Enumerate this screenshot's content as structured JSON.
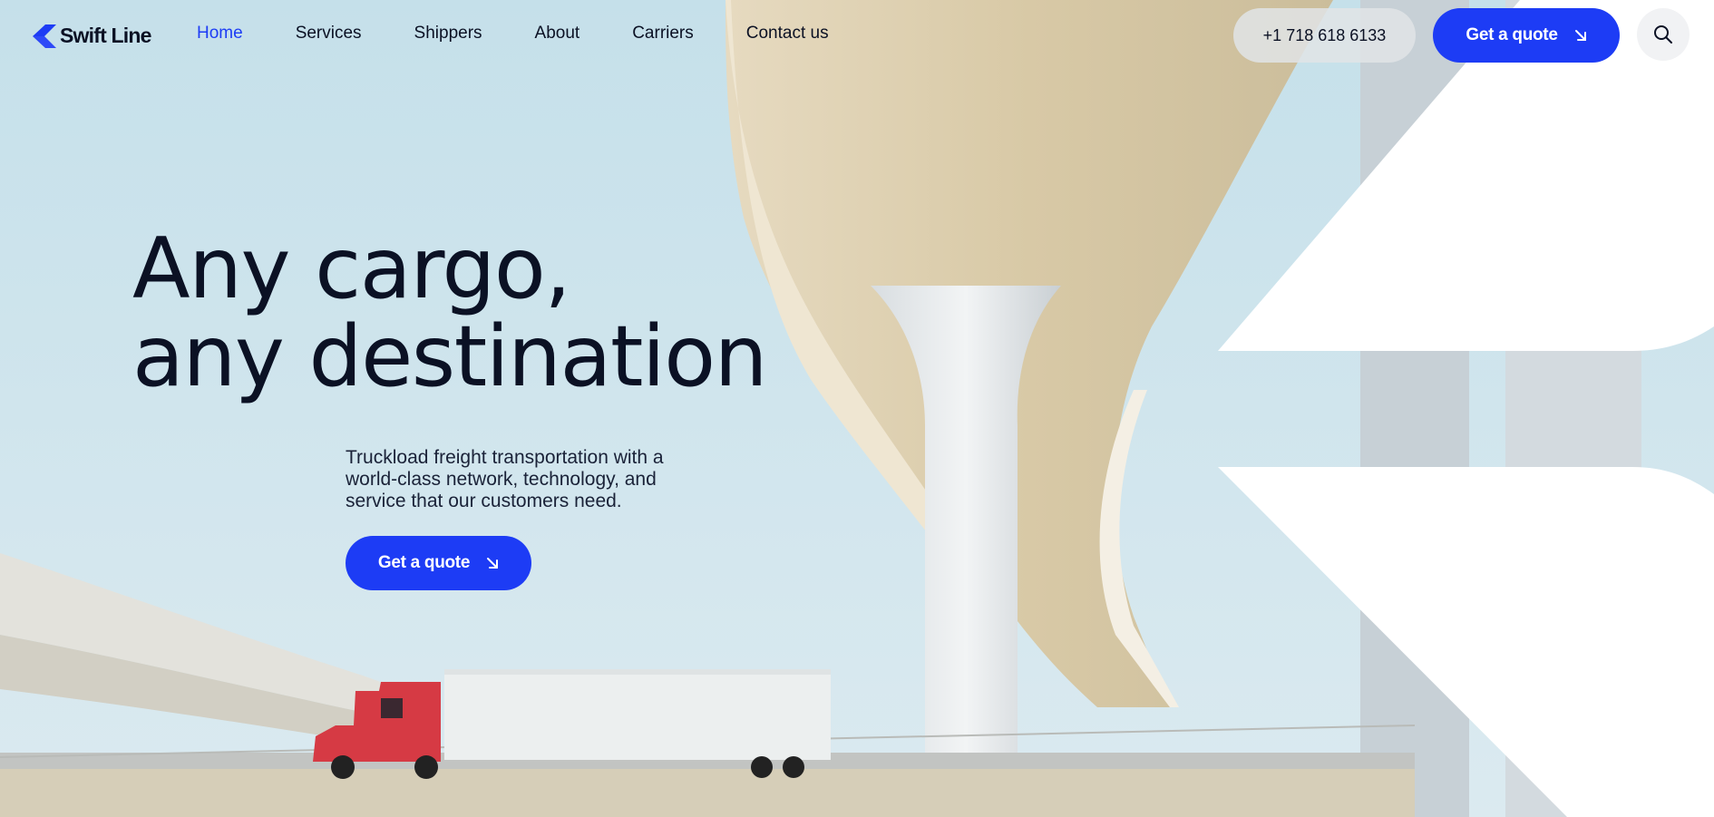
{
  "colors": {
    "brand_blue": "#1d3cf5",
    "text_dark": "#0b1124"
  },
  "header": {
    "logo_text": "Swift Line",
    "nav": [
      {
        "label": "Home",
        "active": true
      },
      {
        "label": "Services"
      },
      {
        "label": "Shippers"
      },
      {
        "label": "About"
      },
      {
        "label": "Carriers"
      },
      {
        "label": "Contact us"
      }
    ],
    "phone": "+1 718 618 6133",
    "cta_label": "Get a quote",
    "search_icon": "search-icon"
  },
  "hero": {
    "headline_line1": "Any cargo,",
    "headline_line2": "any destination",
    "description": "Truckload freight transportation with a world-class network, technology, and service that our customers need.",
    "cta_label": "Get a quote",
    "cta_icon": "arrow-down-right-icon"
  }
}
